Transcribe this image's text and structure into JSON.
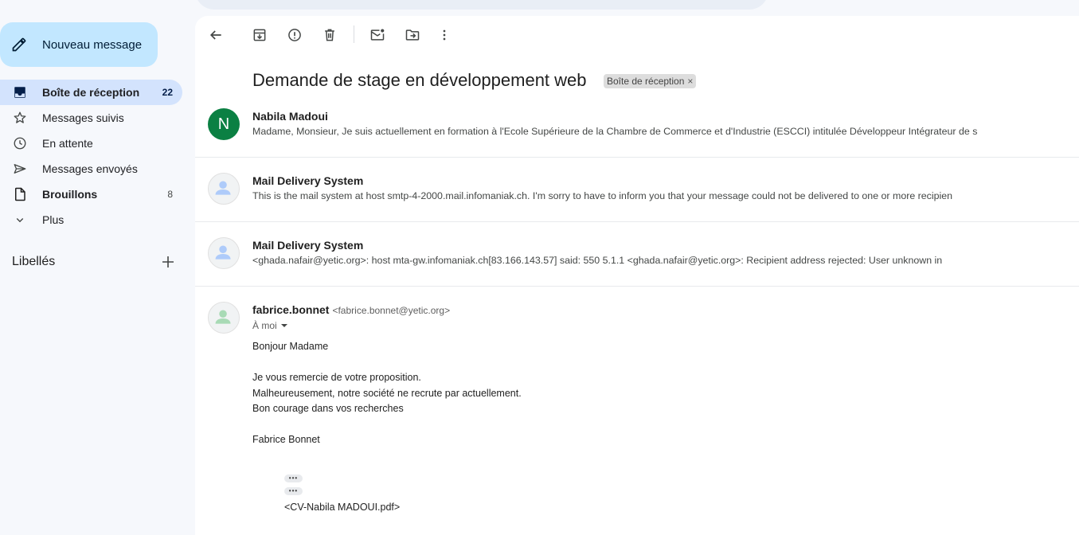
{
  "sidebar": {
    "compose_label": "Nouveau message",
    "items": [
      {
        "label": "Boîte de réception",
        "count": "22"
      },
      {
        "label": "Messages suivis",
        "count": ""
      },
      {
        "label": "En attente",
        "count": ""
      },
      {
        "label": "Messages envoyés",
        "count": ""
      },
      {
        "label": "Brouillons",
        "count": "8"
      },
      {
        "label": "Plus",
        "count": ""
      }
    ],
    "labels_title": "Libellés"
  },
  "thread": {
    "subject": "Demande de stage en développement web",
    "chip_label": "Boîte de réception",
    "chip_close": "×",
    "messages": [
      {
        "avatar": "N",
        "sender": "Nabila Madoui",
        "snippet": "Madame, Monsieur, Je suis actuellement en formation à l'Ecole Supérieure de la Chambre de Commerce et d'Industrie (ESCCI) intitulée Développeur Intégrateur de s"
      },
      {
        "sender": "Mail Delivery System",
        "snippet": "This is the mail system at host smtp-4-2000.mail.infomaniak.ch. I'm sorry to have to inform you that your message could not be delivered to one or more recipien"
      },
      {
        "sender": "Mail Delivery System",
        "snippet": "<ghada.nafair@yetic.org>: host mta-gw.infomaniak.ch[83.166.143.57] said: 550 5.1.1 <ghada.nafair@yetic.org>: Recipient address rejected: User unknown in"
      }
    ],
    "open_message": {
      "sender": "fabrice.bonnet",
      "email": "<fabrice.bonnet@yetic.org>",
      "to": "À moi",
      "body": [
        "Bonjour Madame",
        "",
        "Je vous remercie de votre proposition.",
        "Malheureusement, notre société ne recrute par actuellement.",
        "Bon courage dans vos recherches",
        "",
        "Fabrice Bonnet"
      ],
      "dots": "•••",
      "attachment": "<CV-Nabila MADOUI.pdf>"
    }
  },
  "colors": {
    "compose_bg": "#c2e7ff",
    "active_nav_bg": "#d3e3fd",
    "avatar_green": "#0b8043",
    "page_bg": "#f6f8fc"
  }
}
